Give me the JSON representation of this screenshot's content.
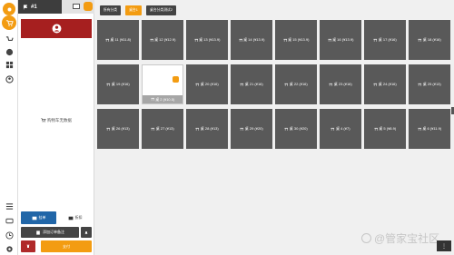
{
  "order_panel": {
    "tab_label": "#1",
    "empty_message": "购物车无数据",
    "hold_label": "挂单",
    "discount_label": "折扣",
    "add_label": "添加订单备注",
    "pay_label": "支付"
  },
  "filters": [
    {
      "label": "所有分类",
      "active": false
    },
    {
      "label": "桌台1",
      "active": true
    },
    {
      "label": "桌台分类测试2",
      "active": false
    }
  ],
  "tables": [
    {
      "label": "桌 11 (¥11.8)",
      "selected": false
    },
    {
      "label": "桌 12 (¥12.9)",
      "selected": false
    },
    {
      "label": "桌 13 (¥13.9)",
      "selected": false
    },
    {
      "label": "桌 14 (¥13.9)",
      "selected": false
    },
    {
      "label": "桌 15 (¥13.9)",
      "selected": false
    },
    {
      "label": "桌 16 (¥13.9)",
      "selected": false
    },
    {
      "label": "桌 17 (¥16)",
      "selected": false
    },
    {
      "label": "桌 18 (¥16)",
      "selected": false
    },
    {
      "label": "桌 19 (¥16)",
      "selected": false
    },
    {
      "label": "桌 2 (¥10.5)",
      "selected": true
    },
    {
      "label": "桌 20 (¥16)",
      "selected": false
    },
    {
      "label": "桌 21 (¥16)",
      "selected": false
    },
    {
      "label": "桌 22 (¥16)",
      "selected": false
    },
    {
      "label": "桌 23 (¥16)",
      "selected": false
    },
    {
      "label": "桌 24 (¥16)",
      "selected": false
    },
    {
      "label": "桌 25 (¥13)",
      "selected": false
    },
    {
      "label": "桌 26 (¥13)",
      "selected": false
    },
    {
      "label": "桌 27 (¥13)",
      "selected": false
    },
    {
      "label": "桌 28 (¥13)",
      "selected": false
    },
    {
      "label": "桌 29 (¥20)",
      "selected": false
    },
    {
      "label": "桌 30 (¥20)",
      "selected": false
    },
    {
      "label": "桌 4 (¥7)",
      "selected": false
    },
    {
      "label": "桌 5 (¥8.9)",
      "selected": false
    },
    {
      "label": "桌 6 (¥11.9)",
      "selected": false
    }
  ],
  "watermark": "@管家宝社区",
  "corner_label": "⋮",
  "colors": {
    "accent": "#f39c12",
    "tile": "#595959",
    "customer": "#a61f1f",
    "hold": "#2166a8"
  }
}
